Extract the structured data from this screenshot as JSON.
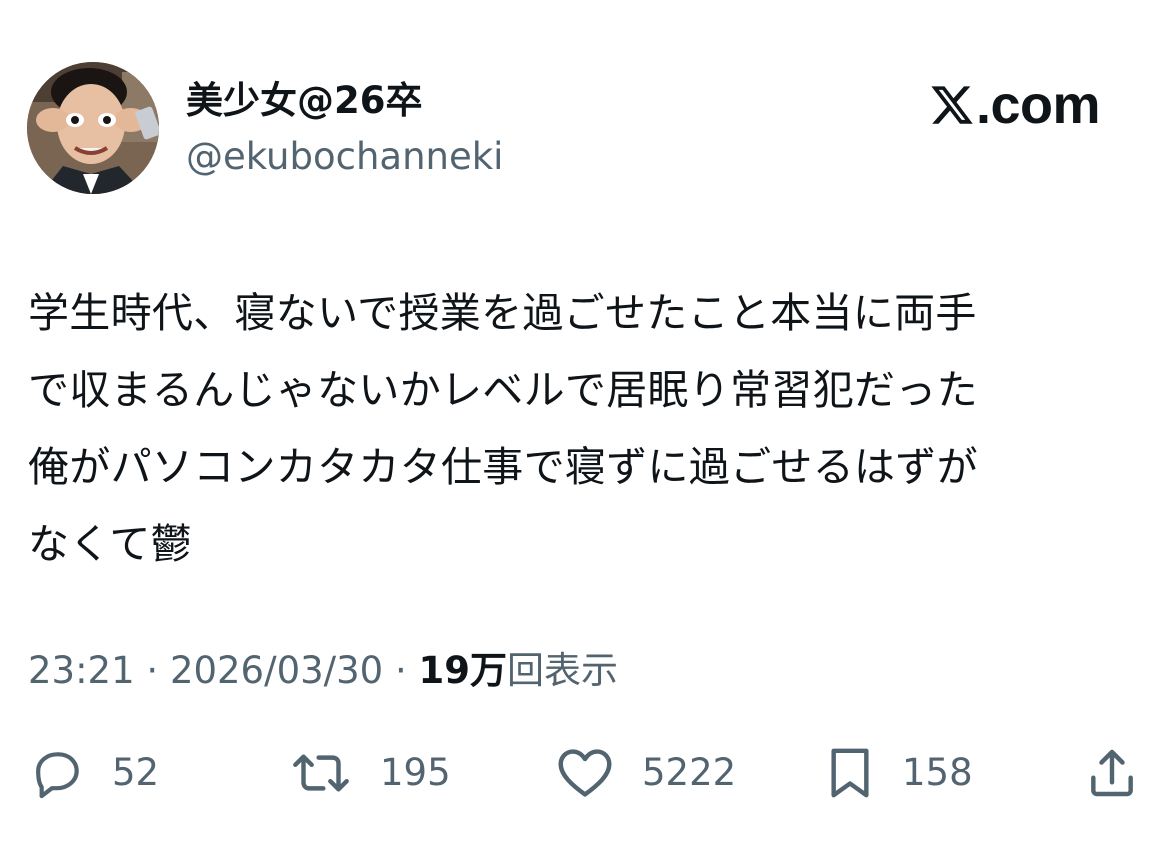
{
  "author": {
    "display_name": "美少女@26卒",
    "handle": "@ekubochanneki",
    "avatar_icon": "profile-photo"
  },
  "brand": {
    "label": ".com",
    "icon": "x-logo-icon"
  },
  "tweet": {
    "text": "学生時代、寝ないで授業を過ごせたこと本当に両手\nで収まるんじゃないかレベルで居眠り常習犯だった\n俺がパソコンカタカタ仕事で寝ずに過ごせるはずが\nなくて鬱"
  },
  "meta": {
    "time": "23:21",
    "separator": " · ",
    "date": "2026/03/30",
    "views_count": "19万",
    "views_label": "回表示"
  },
  "actions": {
    "reply": {
      "icon": "reply-icon",
      "count": "52"
    },
    "repost": {
      "icon": "repost-icon",
      "count": "195"
    },
    "like": {
      "icon": "heart-icon",
      "count": "5222"
    },
    "bookmark": {
      "icon": "bookmark-icon",
      "count": "158"
    },
    "share": {
      "icon": "share-icon"
    }
  },
  "colors": {
    "text_primary": "#0f1419",
    "text_secondary": "#536471",
    "background": "#ffffff"
  }
}
